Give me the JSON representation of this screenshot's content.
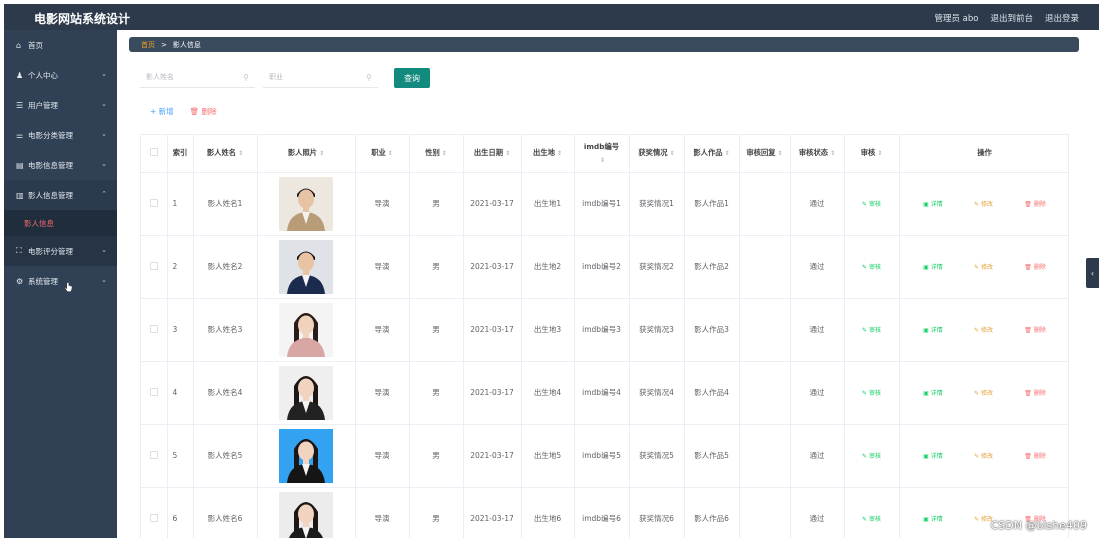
{
  "app": {
    "title": "电影网站系统设计"
  },
  "header": {
    "user": "管理员 abo",
    "to_front": "退出到前台",
    "logout": "退出登录"
  },
  "sidebar": {
    "items": [
      {
        "icon": "home-icon",
        "glyph": "⌂",
        "label": "首页",
        "chevron": ""
      },
      {
        "icon": "user-icon",
        "glyph": "♟",
        "label": "个人中心",
        "chevron": "⌄"
      },
      {
        "icon": "list-icon",
        "glyph": "☰",
        "label": "用户管理",
        "chevron": "⌄"
      },
      {
        "icon": "sliders-icon",
        "glyph": "⚌",
        "label": "电影分类管理",
        "chevron": "⌄"
      },
      {
        "icon": "doc-icon",
        "glyph": "▤",
        "label": "电影信息管理",
        "chevron": "⌄"
      },
      {
        "icon": "card-icon",
        "glyph": "▥",
        "label": "影人信息管理",
        "chevron": "⌃"
      },
      {
        "icon": "",
        "glyph": "",
        "label": "影人信息",
        "chevron": ""
      },
      {
        "icon": "expand-icon",
        "glyph": "⛶",
        "label": "电影评分管理",
        "chevron": "⌄"
      },
      {
        "icon": "settings-icon",
        "glyph": "⚙",
        "label": "系统管理",
        "chevron": "⌄"
      }
    ]
  },
  "breadcrumb": {
    "home": "首页",
    "sep": ">",
    "current": "影人信息"
  },
  "search": {
    "name_placeholder": "影人姓名",
    "job_placeholder": "职业",
    "button": "查询"
  },
  "actions": {
    "add": "+ 新增",
    "delete": "🗑 删除"
  },
  "table": {
    "headers": [
      "索引",
      "影人姓名",
      "影人照片",
      "职业",
      "性别",
      "出生日期",
      "出生地",
      "imdb编号",
      "获奖情况",
      "影人作品",
      "审核回复",
      "审核状态",
      "审核",
      "操作"
    ],
    "sort_mark": "⇕",
    "rows": [
      {
        "idx": "1",
        "name": "影人姓名1",
        "job": "导演",
        "gender": "男",
        "birth": "2021-03-17",
        "place": "出生地1",
        "imdb": "imdb编号1",
        "award": "获奖情况1",
        "works": "影人作品1",
        "reply": "",
        "status": "通过",
        "photo": "man-beige-suit"
      },
      {
        "idx": "2",
        "name": "影人姓名2",
        "job": "导演",
        "gender": "男",
        "birth": "2021-03-17",
        "place": "出生地2",
        "imdb": "imdb编号2",
        "award": "获奖情况2",
        "works": "影人作品2",
        "reply": "",
        "status": "通过",
        "photo": "man-navy-suit"
      },
      {
        "idx": "3",
        "name": "影人姓名3",
        "job": "导演",
        "gender": "男",
        "birth": "2021-03-17",
        "place": "出生地3",
        "imdb": "imdb编号3",
        "award": "获奖情况3",
        "works": "影人作品3",
        "reply": "",
        "status": "通过",
        "photo": "woman-pink-blouse"
      },
      {
        "idx": "4",
        "name": "影人姓名4",
        "job": "导演",
        "gender": "男",
        "birth": "2021-03-17",
        "place": "出生地4",
        "imdb": "imdb编号4",
        "award": "获奖情况4",
        "works": "影人作品4",
        "reply": "",
        "status": "通过",
        "photo": "woman-black-suit-seated"
      },
      {
        "idx": "5",
        "name": "影人姓名5",
        "job": "导演",
        "gender": "男",
        "birth": "2021-03-17",
        "place": "出生地5",
        "imdb": "imdb编号5",
        "award": "获奖情况5",
        "works": "影人作品5",
        "reply": "",
        "status": "通过",
        "photo": "woman-blue-background"
      },
      {
        "idx": "6",
        "name": "影人姓名6",
        "job": "导演",
        "gender": "男",
        "birth": "2021-03-17",
        "place": "出生地6",
        "imdb": "imdb编号6",
        "award": "获奖情况6",
        "works": "影人作品6",
        "reply": "",
        "status": "通过",
        "photo": "woman-black-suit"
      }
    ],
    "op_audit": "✎ 审核",
    "op_detail": "▣ 详情",
    "op_edit": "✎ 修改",
    "op_delete": "🗑 删除"
  },
  "side_toggle": "‹",
  "watermark": "CSDN @bishe409"
}
